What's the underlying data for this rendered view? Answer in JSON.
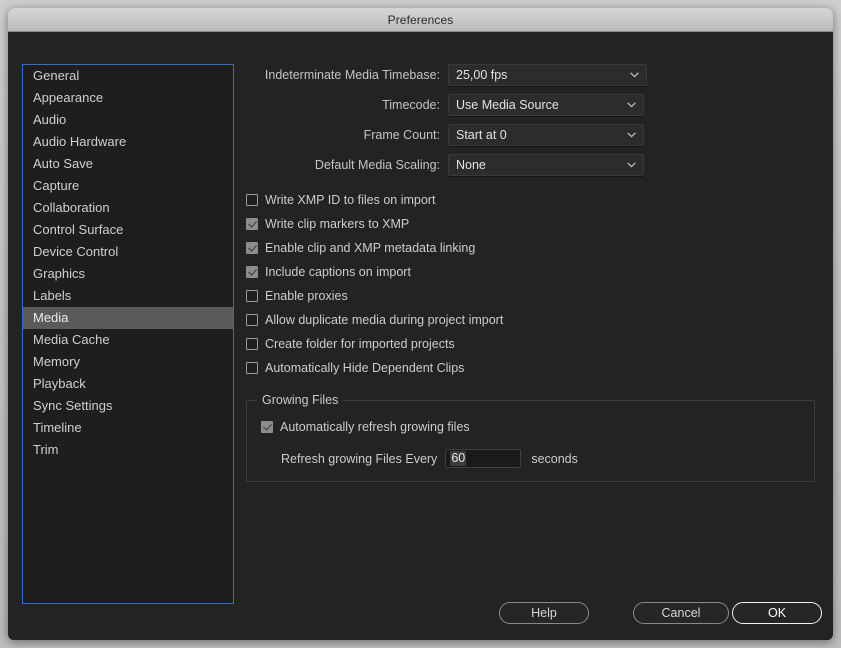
{
  "window": {
    "title": "Preferences"
  },
  "sidebar": {
    "items": [
      {
        "label": "General",
        "selected": false
      },
      {
        "label": "Appearance",
        "selected": false
      },
      {
        "label": "Audio",
        "selected": false
      },
      {
        "label": "Audio Hardware",
        "selected": false
      },
      {
        "label": "Auto Save",
        "selected": false
      },
      {
        "label": "Capture",
        "selected": false
      },
      {
        "label": "Collaboration",
        "selected": false
      },
      {
        "label": "Control Surface",
        "selected": false
      },
      {
        "label": "Device Control",
        "selected": false
      },
      {
        "label": "Graphics",
        "selected": false
      },
      {
        "label": "Labels",
        "selected": false
      },
      {
        "label": "Media",
        "selected": true
      },
      {
        "label": "Media Cache",
        "selected": false
      },
      {
        "label": "Memory",
        "selected": false
      },
      {
        "label": "Playback",
        "selected": false
      },
      {
        "label": "Sync Settings",
        "selected": false
      },
      {
        "label": "Timeline",
        "selected": false
      },
      {
        "label": "Trim",
        "selected": false
      }
    ]
  },
  "media_panel": {
    "dropdowns": [
      {
        "label": "Indeterminate Media Timebase:",
        "value": "25,00 fps",
        "icon": "chevron-down-icon"
      },
      {
        "label": "Timecode:",
        "value": "Use Media Source",
        "icon": "chevron-down-icon"
      },
      {
        "label": "Frame Count:",
        "value": "Start at 0",
        "icon": "chevron-down-icon"
      },
      {
        "label": "Default Media Scaling:",
        "value": "None",
        "icon": "chevron-down-icon"
      }
    ],
    "checkboxes": [
      {
        "label": "Write XMP ID to files on import",
        "checked": false
      },
      {
        "label": "Write clip markers to XMP",
        "checked": true
      },
      {
        "label": "Enable clip and XMP metadata linking",
        "checked": true
      },
      {
        "label": "Include captions on import",
        "checked": true
      },
      {
        "label": "Enable proxies",
        "checked": false
      },
      {
        "label": "Allow duplicate media during project import",
        "checked": false
      },
      {
        "label": "Create folder for imported projects",
        "checked": false
      },
      {
        "label": "Automatically Hide Dependent Clips",
        "checked": false
      }
    ],
    "growing_files": {
      "legend": "Growing Files",
      "auto_refresh": {
        "label": "Automatically refresh growing files",
        "checked": true
      },
      "refresh_interval": {
        "label": "Refresh growing Files Every",
        "value": "60",
        "unit": "seconds"
      }
    }
  },
  "footer": {
    "help_label": "Help",
    "cancel_label": "Cancel",
    "ok_label": "OK"
  },
  "colors": {
    "window_bg": "#232323",
    "titlebar": "#c9c9c9",
    "focus_border": "#2d6fd1",
    "selection_bg": "#5a5a5a",
    "text": "#cccccc"
  }
}
